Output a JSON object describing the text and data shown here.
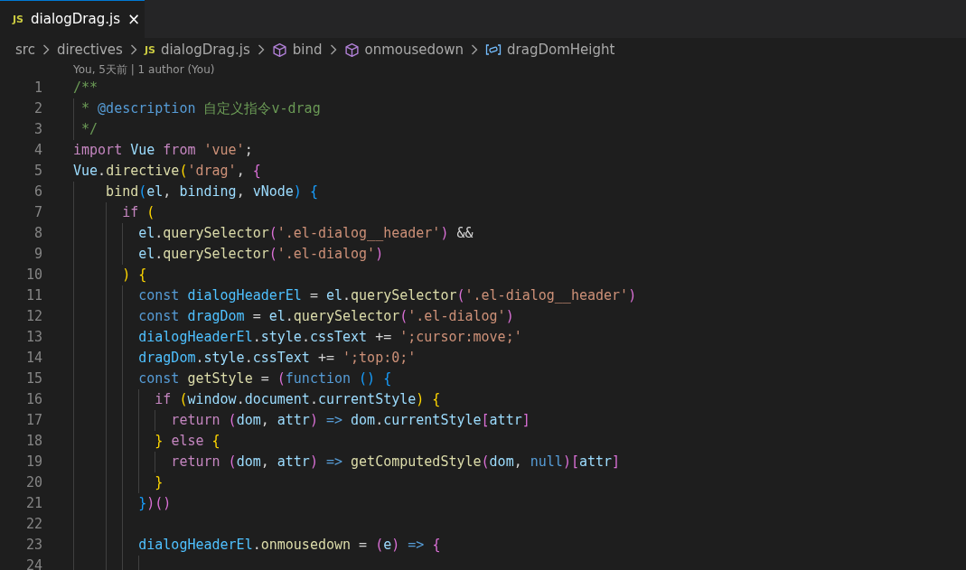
{
  "tabs": [
    {
      "icon_text": "JS",
      "label": "dialogDrag.js",
      "close": "×",
      "selected": true
    }
  ],
  "breadcrumb": [
    {
      "kind": "folder",
      "label": "src"
    },
    {
      "kind": "folder",
      "label": "directives"
    },
    {
      "kind": "file",
      "icon_text": "JS",
      "label": "dialogDrag.js"
    },
    {
      "kind": "method",
      "label": "bind"
    },
    {
      "kind": "method",
      "label": "onmousedown"
    },
    {
      "kind": "variable",
      "label": "dragDomHeight"
    }
  ],
  "codelens": "You, 5天前 | 1 author (You)",
  "lines": [
    {
      "number": "1",
      "tokens": [
        {
          "kind": "comment",
          "text": "/**"
        }
      ]
    },
    {
      "number": "2",
      "tokens": [
        {
          "kind": "comment",
          "text": " * "
        },
        {
          "kind": "doctag",
          "text": "@description"
        },
        {
          "kind": "comment",
          "text": " 自定义指令v-drag"
        }
      ]
    },
    {
      "number": "3",
      "tokens": [
        {
          "kind": "comment",
          "text": " */"
        }
      ]
    },
    {
      "number": "4",
      "tokens": [
        {
          "kind": "keyword",
          "text": "import "
        },
        {
          "kind": "var",
          "text": "Vue "
        },
        {
          "kind": "keyword",
          "text": "from "
        },
        {
          "kind": "string",
          "text": "'vue'"
        },
        {
          "kind": "plain",
          "text": ";"
        }
      ]
    },
    {
      "number": "5",
      "tokens": [
        {
          "kind": "var",
          "text": "Vue"
        },
        {
          "kind": "plain",
          "text": "."
        },
        {
          "kind": "function",
          "text": "directive"
        },
        {
          "kind": "bracket1",
          "text": "("
        },
        {
          "kind": "string",
          "text": "'drag'"
        },
        {
          "kind": "plain",
          "text": ", "
        },
        {
          "kind": "bracket2",
          "text": "{"
        }
      ]
    },
    {
      "number": "6",
      "tokens": [
        {
          "kind": "function",
          "text": "    bind"
        },
        {
          "kind": "bracket3",
          "text": "("
        },
        {
          "kind": "var",
          "text": "el"
        },
        {
          "kind": "plain",
          "text": ", "
        },
        {
          "kind": "var",
          "text": "binding"
        },
        {
          "kind": "plain",
          "text": ", "
        },
        {
          "kind": "var",
          "text": "vNode"
        },
        {
          "kind": "bracket3",
          "text": ") "
        },
        {
          "kind": "bracket3",
          "text": "{"
        }
      ]
    },
    {
      "number": "7",
      "tokens": [
        {
          "kind": "keyword",
          "text": "      if "
        },
        {
          "kind": "bracket1",
          "text": "("
        }
      ]
    },
    {
      "number": "8",
      "tokens": [
        {
          "kind": "var",
          "text": "        el"
        },
        {
          "kind": "plain",
          "text": "."
        },
        {
          "kind": "function",
          "text": "querySelector"
        },
        {
          "kind": "bracket2",
          "text": "("
        },
        {
          "kind": "string",
          "text": "'.el-dialog__header'"
        },
        {
          "kind": "bracket2",
          "text": ")"
        },
        {
          "kind": "plain",
          "text": " &&"
        }
      ]
    },
    {
      "number": "9",
      "tokens": [
        {
          "kind": "var",
          "text": "        el"
        },
        {
          "kind": "plain",
          "text": "."
        },
        {
          "kind": "function",
          "text": "querySelector"
        },
        {
          "kind": "bracket2",
          "text": "("
        },
        {
          "kind": "string",
          "text": "'.el-dialog'"
        },
        {
          "kind": "bracket2",
          "text": ")"
        }
      ]
    },
    {
      "number": "10",
      "tokens": [
        {
          "kind": "bracket1",
          "text": "      ) {"
        }
      ]
    },
    {
      "number": "11",
      "tokens": [
        {
          "kind": "storage",
          "text": "        const "
        },
        {
          "kind": "constant",
          "text": "dialogHeaderEl"
        },
        {
          "kind": "plain",
          "text": " = "
        },
        {
          "kind": "var",
          "text": "el"
        },
        {
          "kind": "plain",
          "text": "."
        },
        {
          "kind": "function",
          "text": "querySelector"
        },
        {
          "kind": "bracket2",
          "text": "("
        },
        {
          "kind": "string",
          "text": "'.el-dialog__header'"
        },
        {
          "kind": "bracket2",
          "text": ")"
        }
      ]
    },
    {
      "number": "12",
      "tokens": [
        {
          "kind": "storage",
          "text": "        const "
        },
        {
          "kind": "constant",
          "text": "dragDom"
        },
        {
          "kind": "plain",
          "text": " = "
        },
        {
          "kind": "var",
          "text": "el"
        },
        {
          "kind": "plain",
          "text": "."
        },
        {
          "kind": "function",
          "text": "querySelector"
        },
        {
          "kind": "bracket2",
          "text": "("
        },
        {
          "kind": "string",
          "text": "'.el-dialog'"
        },
        {
          "kind": "bracket2",
          "text": ")"
        }
      ]
    },
    {
      "number": "13",
      "tokens": [
        {
          "kind": "constant",
          "text": "        dialogHeaderEl"
        },
        {
          "kind": "plain",
          "text": "."
        },
        {
          "kind": "var",
          "text": "style"
        },
        {
          "kind": "plain",
          "text": "."
        },
        {
          "kind": "var",
          "text": "cssText"
        },
        {
          "kind": "plain",
          "text": " += "
        },
        {
          "kind": "string",
          "text": "';cursor:move;'"
        }
      ]
    },
    {
      "number": "14",
      "tokens": [
        {
          "kind": "constant",
          "text": "        dragDom"
        },
        {
          "kind": "plain",
          "text": "."
        },
        {
          "kind": "var",
          "text": "style"
        },
        {
          "kind": "plain",
          "text": "."
        },
        {
          "kind": "var",
          "text": "cssText"
        },
        {
          "kind": "plain",
          "text": " += "
        },
        {
          "kind": "string",
          "text": "';top:0;'"
        }
      ]
    },
    {
      "number": "15",
      "tokens": [
        {
          "kind": "storage",
          "text": "        const "
        },
        {
          "kind": "function",
          "text": "getStyle"
        },
        {
          "kind": "plain",
          "text": " = "
        },
        {
          "kind": "bracket2",
          "text": "("
        },
        {
          "kind": "storage",
          "text": "function "
        },
        {
          "kind": "bracket3",
          "text": "() {"
        }
      ]
    },
    {
      "number": "16",
      "tokens": [
        {
          "kind": "keyword",
          "text": "          if "
        },
        {
          "kind": "bracket1",
          "text": "("
        },
        {
          "kind": "var",
          "text": "window"
        },
        {
          "kind": "plain",
          "text": "."
        },
        {
          "kind": "var",
          "text": "document"
        },
        {
          "kind": "plain",
          "text": "."
        },
        {
          "kind": "var",
          "text": "currentStyle"
        },
        {
          "kind": "bracket1",
          "text": ") {"
        }
      ]
    },
    {
      "number": "17",
      "tokens": [
        {
          "kind": "keyword",
          "text": "            return "
        },
        {
          "kind": "bracket2",
          "text": "("
        },
        {
          "kind": "var",
          "text": "dom"
        },
        {
          "kind": "plain",
          "text": ", "
        },
        {
          "kind": "var",
          "text": "attr"
        },
        {
          "kind": "bracket2",
          "text": ") "
        },
        {
          "kind": "storage",
          "text": "=> "
        },
        {
          "kind": "var",
          "text": "dom"
        },
        {
          "kind": "plain",
          "text": "."
        },
        {
          "kind": "var",
          "text": "currentStyle"
        },
        {
          "kind": "bracket2",
          "text": "["
        },
        {
          "kind": "var",
          "text": "attr"
        },
        {
          "kind": "bracket2",
          "text": "]"
        }
      ]
    },
    {
      "number": "18",
      "tokens": [
        {
          "kind": "bracket1",
          "text": "          } "
        },
        {
          "kind": "keyword",
          "text": "else "
        },
        {
          "kind": "bracket1",
          "text": "{"
        }
      ]
    },
    {
      "number": "19",
      "tokens": [
        {
          "kind": "keyword",
          "text": "            return "
        },
        {
          "kind": "bracket2",
          "text": "("
        },
        {
          "kind": "var",
          "text": "dom"
        },
        {
          "kind": "plain",
          "text": ", "
        },
        {
          "kind": "var",
          "text": "attr"
        },
        {
          "kind": "bracket2",
          "text": ") "
        },
        {
          "kind": "storage",
          "text": "=> "
        },
        {
          "kind": "function",
          "text": "getComputedStyle"
        },
        {
          "kind": "bracket2",
          "text": "("
        },
        {
          "kind": "var",
          "text": "dom"
        },
        {
          "kind": "plain",
          "text": ", "
        },
        {
          "kind": "storage",
          "text": "null"
        },
        {
          "kind": "bracket2",
          "text": ")["
        },
        {
          "kind": "var",
          "text": "attr"
        },
        {
          "kind": "bracket2",
          "text": "]"
        }
      ]
    },
    {
      "number": "20",
      "tokens": [
        {
          "kind": "bracket1",
          "text": "          }"
        }
      ]
    },
    {
      "number": "21",
      "tokens": [
        {
          "kind": "bracket3",
          "text": "        }"
        },
        {
          "kind": "bracket2",
          "text": ")()"
        }
      ]
    },
    {
      "number": "22"
    },
    {
      "number": "23",
      "tokens": [
        {
          "kind": "constant",
          "text": "        dialogHeaderEl"
        },
        {
          "kind": "plain",
          "text": "."
        },
        {
          "kind": "function",
          "text": "onmousedown"
        },
        {
          "kind": "plain",
          "text": " = "
        },
        {
          "kind": "bracket2",
          "text": "("
        },
        {
          "kind": "var",
          "text": "e"
        },
        {
          "kind": "bracket2",
          "text": ") "
        },
        {
          "kind": "storage",
          "text": "=> "
        },
        {
          "kind": "bracket2",
          "text": "{"
        }
      ]
    },
    {
      "number": "24"
    }
  ]
}
